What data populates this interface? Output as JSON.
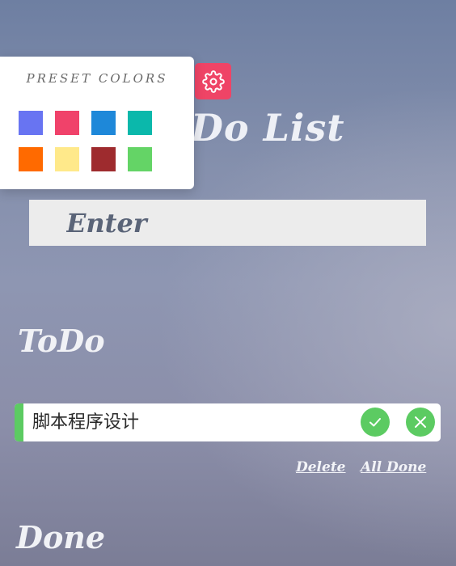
{
  "app": {
    "title": "Do List"
  },
  "preset": {
    "title": "PRESET COLORS",
    "colors": [
      "#6874f2",
      "#f0426a",
      "#1e88d9",
      "#0bb8ab",
      "#ff6a00",
      "#ffe98a",
      "#9e2b2e",
      "#64d466"
    ]
  },
  "settings": {
    "icon": "gear-icon",
    "color": "#ef4466"
  },
  "input": {
    "placeholder": "Enter"
  },
  "todo": {
    "title": "ToDo",
    "items": [
      {
        "text": "脚本程序设计",
        "accent": "#5ccb62"
      }
    ],
    "actions": {
      "delete_label": "Delete",
      "all_done_label": "All Done"
    }
  },
  "done": {
    "title": "Done"
  }
}
